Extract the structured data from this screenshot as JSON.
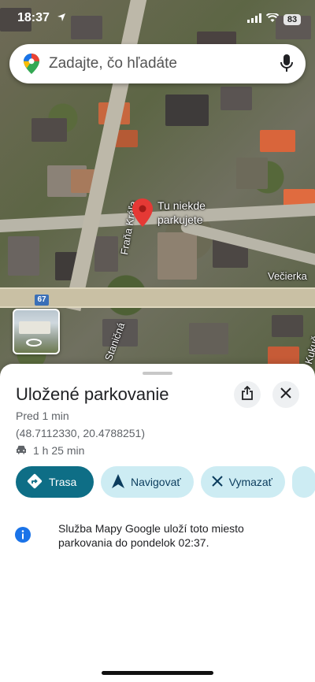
{
  "status_bar": {
    "time": "18:37",
    "battery": "83"
  },
  "search": {
    "placeholder": "Zadajte, čo hľadáte"
  },
  "map": {
    "marker_label_line1": "Tu niekde",
    "marker_label_line2": "parkujete",
    "street_frana_krala": "Fraňa Kráľa",
    "street_stanicna": "Staničná",
    "street_kukucin": "Kukuč",
    "poi_vecierka": "Večierka",
    "road_shield": "67"
  },
  "sheet": {
    "title": "Uložené parkovanie",
    "time_ago": "Pred 1 min",
    "coordinates": "(48.7112330, 20.4788251)",
    "duration": "1 h 25 min",
    "info_text": "Služba Mapy Google uloží toto miesto parkovania do pondelok 02:37."
  },
  "actions": {
    "route": "Trasa",
    "navigate": "Navigovať",
    "delete": "Vymazať"
  },
  "colors": {
    "primary_chip": "#0e6e86",
    "secondary_chip": "#cdecf3",
    "marker_red": "#e53935",
    "info_blue": "#1a73e8"
  }
}
